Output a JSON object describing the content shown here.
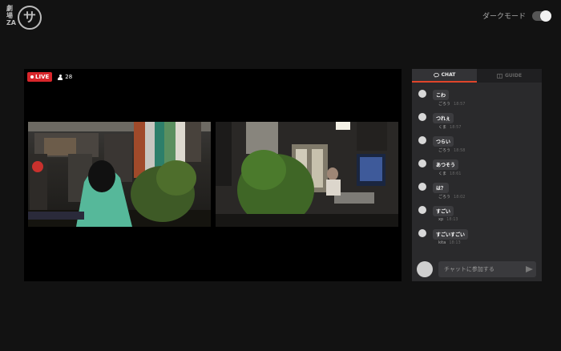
{
  "logo": {
    "text_lines": [
      "劇",
      "場",
      "ZA"
    ],
    "mark": "サ"
  },
  "dark_mode": {
    "label": "ダークモード",
    "enabled": true
  },
  "stream": {
    "live_label": "LIVE",
    "viewer_count": "28"
  },
  "chat": {
    "tabs": [
      {
        "label": "CHAT",
        "icon": "chat-bubble-icon",
        "active": true
      },
      {
        "label": "GUIDE",
        "icon": "guide-icon",
        "active": false
      }
    ],
    "messages": [
      {
        "text": "こわ",
        "user": "ごろう",
        "time": "18:57"
      },
      {
        "text": "つれぇ",
        "user": "くま",
        "time": "18:57"
      },
      {
        "text": "つらい",
        "user": "ごろう",
        "time": "18:58"
      },
      {
        "text": "あつそう",
        "user": "くま",
        "time": "18:61"
      },
      {
        "text": "は？",
        "user": "ごろう",
        "time": "18:02"
      },
      {
        "text": "すごい",
        "user": "xp",
        "time": "18:13"
      },
      {
        "text": "すごいすごい",
        "user": "kita",
        "time": "18:13"
      }
    ],
    "input_placeholder": "チャットに参加する"
  }
}
